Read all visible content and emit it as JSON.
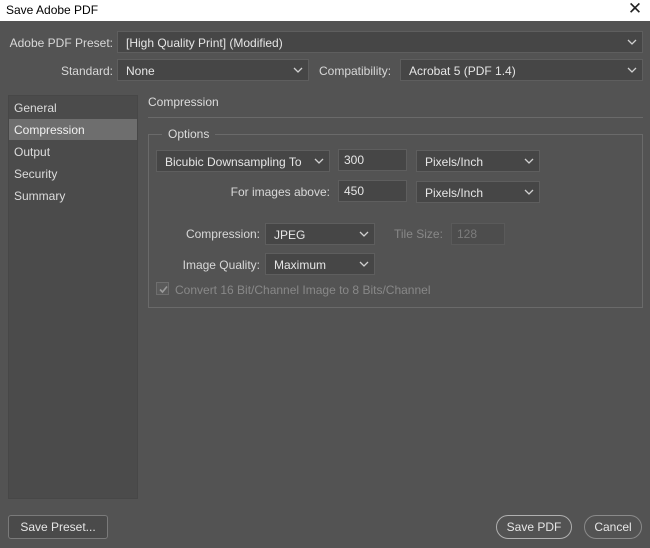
{
  "window": {
    "title": "Save Adobe PDF",
    "close_glyph": "✕"
  },
  "preset": {
    "label": "Adobe PDF Preset:",
    "value": "[High Quality Print] (Modified)"
  },
  "standard": {
    "label": "Standard:",
    "value": "None"
  },
  "compatibility": {
    "label": "Compatibility:",
    "value": "Acrobat 5 (PDF 1.4)"
  },
  "sidebar": {
    "items": [
      {
        "label": "General",
        "selected": false
      },
      {
        "label": "Compression",
        "selected": true
      },
      {
        "label": "Output",
        "selected": false
      },
      {
        "label": "Security",
        "selected": false
      },
      {
        "label": "Summary",
        "selected": false
      }
    ]
  },
  "panel": {
    "heading": "Compression",
    "options_title": "Options",
    "downsampling": {
      "method": "Bicubic Downsampling To",
      "value": "300",
      "unit": "Pixels/Inch"
    },
    "above": {
      "label": "For images above:",
      "value": "450",
      "unit": "Pixels/Inch"
    },
    "compression": {
      "label": "Compression:",
      "value": "JPEG"
    },
    "tile": {
      "label": "Tile Size:",
      "value": "128"
    },
    "quality": {
      "label": "Image Quality:",
      "value": "Maximum"
    },
    "convert": {
      "label": "Convert 16 Bit/Channel Image to 8 Bits/Channel",
      "checked": true,
      "disabled": true
    }
  },
  "buttons": {
    "save_preset": "Save Preset...",
    "save_pdf": "Save PDF",
    "cancel": "Cancel"
  },
  "icons": {
    "chevron": "chevron-down-icon",
    "close": "close-icon",
    "check": "check-icon"
  }
}
